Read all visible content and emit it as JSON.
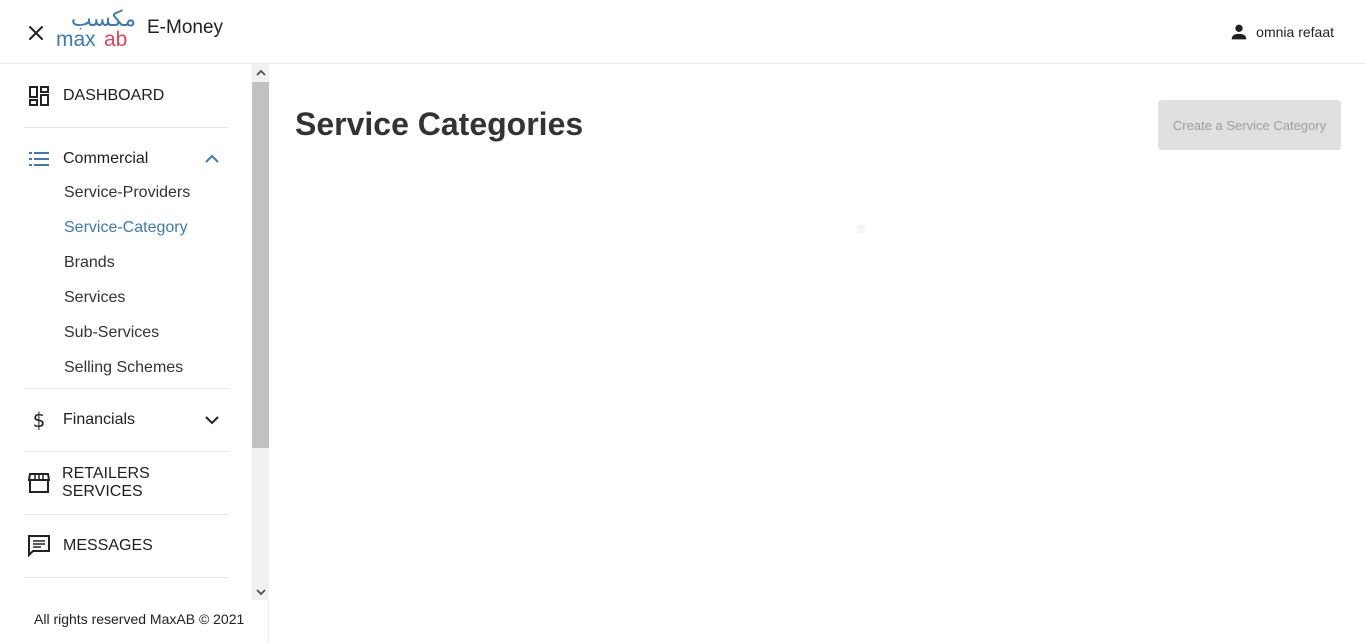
{
  "header": {
    "app_title": "E-Money",
    "logo_arabic": "مكسب",
    "logo_latin_left": "max",
    "logo_latin_right": "ab",
    "user_name": "omnia refaat",
    "brand_blue": "#3d7ab3",
    "brand_pink": "#e0455f"
  },
  "sidebar": {
    "items": [
      {
        "label": "DASHBOARD",
        "icon": "dashboard-icon"
      },
      {
        "label": "Commercial",
        "icon": "list-icon",
        "expanded": true,
        "children": [
          {
            "label": "Service-Providers"
          },
          {
            "label": "Service-Category",
            "active": true
          },
          {
            "label": "Brands"
          },
          {
            "label": "Services"
          },
          {
            "label": "Sub-Services"
          },
          {
            "label": "Selling Schemes"
          }
        ]
      },
      {
        "label": "Financials",
        "icon": "dollar-icon",
        "expanded": false
      },
      {
        "label": "RETAILERS SERVICES",
        "icon": "store-icon"
      },
      {
        "label": "MESSAGES",
        "icon": "message-icon"
      }
    ],
    "active_color": "#3d7ab3"
  },
  "footer": {
    "text": "All rights reserved MaxAB © 2021"
  },
  "main": {
    "page_title": "Service Categories",
    "create_button_label": "Create a Service Category"
  }
}
